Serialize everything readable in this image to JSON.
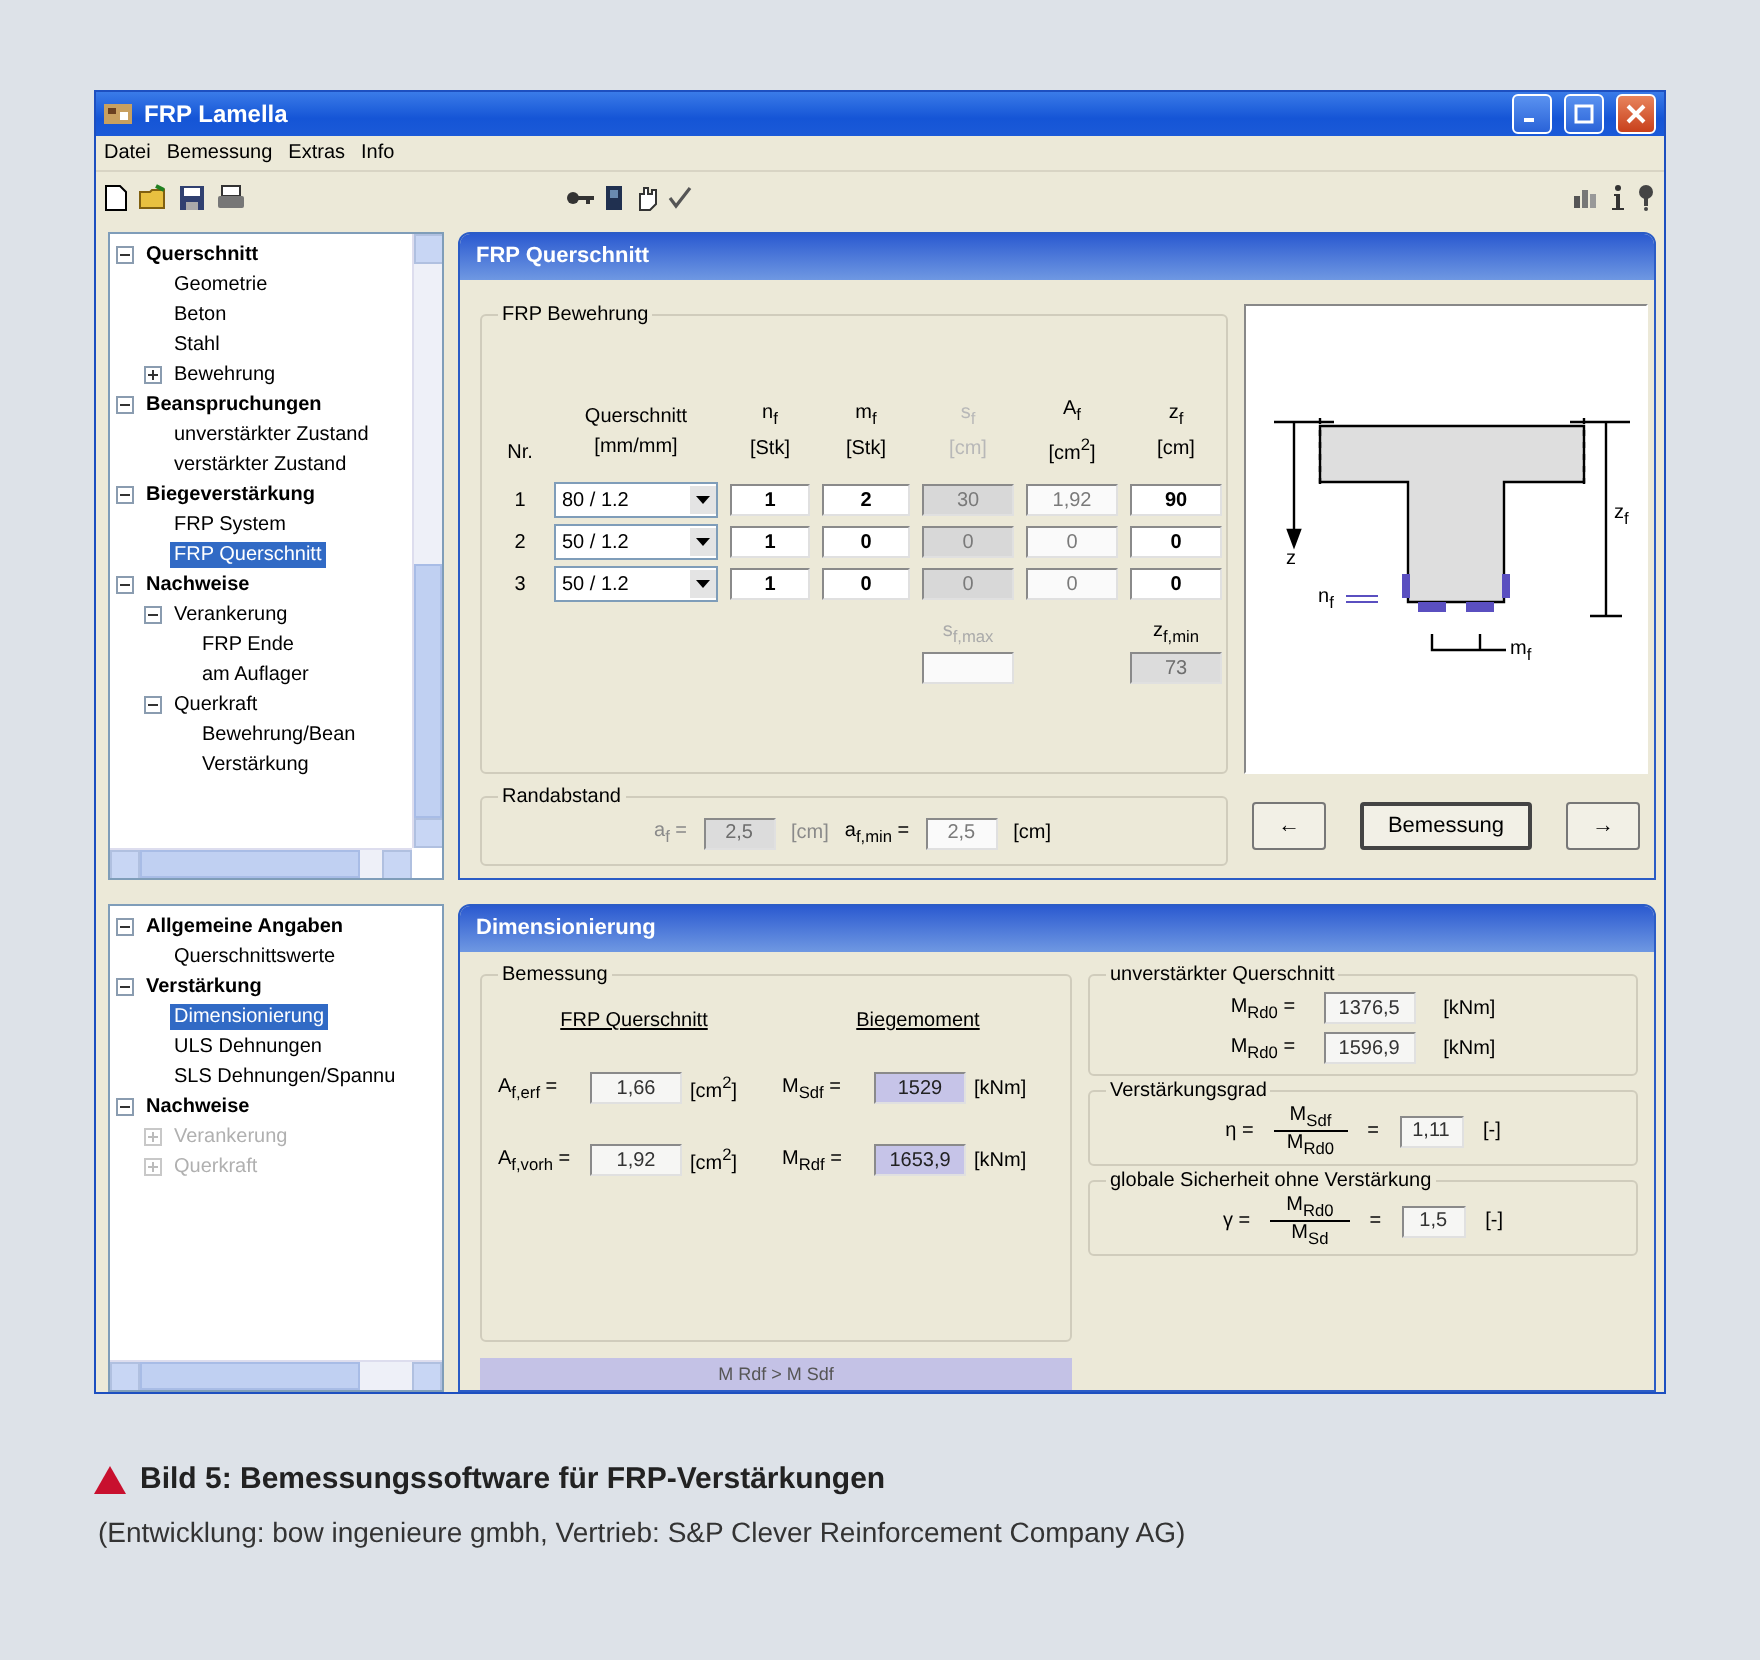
{
  "window": {
    "title": "FRP Lamella"
  },
  "menu": [
    "Datei",
    "Bemessung",
    "Extras",
    "Info"
  ],
  "tree_top": {
    "nodes": [
      {
        "label": "Querschnitt",
        "expanded": true,
        "selected": false,
        "children": [
          {
            "label": "Geometrie",
            "selected": false
          },
          {
            "label": "Beton",
            "selected": false
          },
          {
            "label": "Stahl",
            "selected": false
          },
          {
            "label": "Bewehrung",
            "expanded": false,
            "selected": false
          }
        ]
      },
      {
        "label": "Beanspruchungen",
        "expanded": true,
        "selected": false,
        "children": [
          {
            "label": "unverstärkter Zustand",
            "selected": false
          },
          {
            "label": "verstärkter Zustand",
            "selected": false
          }
        ]
      },
      {
        "label": "Biegeverstärkung",
        "expanded": true,
        "selected": false,
        "children": [
          {
            "label": "FRP System",
            "selected": false
          },
          {
            "label": "FRP Querschnitt",
            "selected": true
          }
        ]
      },
      {
        "label": "Nachweise",
        "expanded": true,
        "selected": false,
        "children": [
          {
            "label": "Verankerung",
            "expanded": true,
            "selected": false,
            "children": [
              {
                "label": "FRP Ende",
                "selected": false
              },
              {
                "label": "am Auflager",
                "selected": false
              }
            ]
          },
          {
            "label": "Querkraft",
            "expanded": true,
            "selected": false,
            "children": [
              {
                "label": "Bewehrung/Bean",
                "selected": false
              },
              {
                "label": "Verstärkung",
                "selected": false
              }
            ]
          }
        ]
      }
    ]
  },
  "panel_top": {
    "title": "FRP Querschnitt",
    "group": "FRP Bewehrung",
    "columns": [
      {
        "label": "Nr."
      },
      {
        "label": "Querschnitt",
        "unit": "[mm/mm]"
      },
      {
        "label": "n$_{f}$",
        "unit": "[Stk]"
      },
      {
        "label": "m$_{f}$",
        "unit": "[Stk]"
      },
      {
        "label": "s$_{f}$",
        "unit": "[cm]",
        "disabled": true
      },
      {
        "label": "A$_{f}$",
        "unit": "[cm$^{2}$]"
      },
      {
        "label": "z$_{f}$",
        "unit": "[cm]"
      }
    ],
    "rows": [
      {
        "cells": [
          {
            "kind": "label",
            "value": "1"
          },
          {
            "kind": "dropdown",
            "value": "80 / 1.2"
          },
          {
            "kind": "field",
            "value": "1",
            "disabled": false,
            "readonly": false
          },
          {
            "kind": "field",
            "value": "2",
            "disabled": false,
            "readonly": false
          },
          {
            "kind": "field",
            "value": "30",
            "disabled": true,
            "readonly": true
          },
          {
            "kind": "field",
            "value": "1,92",
            "disabled": false,
            "readonly": true
          },
          {
            "kind": "field",
            "value": "90",
            "disabled": false,
            "readonly": false
          }
        ]
      },
      {
        "cells": [
          {
            "kind": "label",
            "value": "2"
          },
          {
            "kind": "dropdown",
            "value": "50 / 1.2"
          },
          {
            "kind": "field",
            "value": "1",
            "disabled": false,
            "readonly": false
          },
          {
            "kind": "field",
            "value": "0",
            "disabled": false,
            "readonly": false
          },
          {
            "kind": "field",
            "value": "0",
            "disabled": true,
            "readonly": true
          },
          {
            "kind": "field",
            "value": "0",
            "disabled": false,
            "readonly": true
          },
          {
            "kind": "field",
            "value": "0",
            "disabled": false,
            "readonly": false
          }
        ]
      },
      {
        "cells": [
          {
            "kind": "label",
            "value": "3"
          },
          {
            "kind": "dropdown",
            "value": "50 / 1.2"
          },
          {
            "kind": "field",
            "value": "1",
            "disabled": false,
            "readonly": false
          },
          {
            "kind": "field",
            "value": "0",
            "disabled": false,
            "readonly": false
          },
          {
            "kind": "field",
            "value": "0",
            "disabled": true,
            "readonly": true
          },
          {
            "kind": "field",
            "value": "0",
            "disabled": false,
            "readonly": true
          },
          {
            "kind": "field",
            "value": "0",
            "disabled": false,
            "readonly": false
          }
        ]
      }
    ],
    "s_max": {
      "label": "s$_{f,max}$",
      "disabled": false
    },
    "z_min": {
      "label": "z$_{f,min}$",
      "value": "73",
      "disabled": true
    },
    "edge": {
      "legend": "Randabstand",
      "fields": [
        {
          "label": "a$_{f}$ =",
          "value": "2,5",
          "unit": "[cm]",
          "disabled": true
        },
        {
          "label": "a$_{f,min}$ =",
          "value": "2,5",
          "unit": "[cm]",
          "disabled": false
        }
      ]
    },
    "diagram_labels": [
      "z",
      "z$_{f}$",
      "n$_{f}$",
      "m$_{f}$"
    ],
    "buttons": [
      "←",
      "Bemessung",
      "→"
    ]
  },
  "tree_bottom": {
    "nodes": [
      {
        "label": "Allgemeine Angaben",
        "expanded": true,
        "selected": false,
        "disabled": false,
        "children": [
          {
            "label": "Querschnittswerte",
            "selected": false,
            "disabled": false
          }
        ]
      },
      {
        "label": "Verstärkung",
        "expanded": true,
        "selected": false,
        "disabled": false,
        "children": [
          {
            "label": "Dimensionierung",
            "selected": true,
            "disabled": false
          },
          {
            "label": "ULS Dehnungen",
            "selected": false,
            "disabled": false
          },
          {
            "label": "SLS Dehnungen/Spannu",
            "selected": false,
            "disabled": false
          }
        ]
      },
      {
        "label": "Nachweise",
        "expanded": true,
        "selected": false,
        "disabled": false,
        "children": [
          {
            "label": "Verankerung",
            "expanded": false,
            "selected": false,
            "disabled": true
          },
          {
            "label": "Querkraft",
            "expanded": false,
            "selected": false,
            "disabled": true
          }
        ]
      }
    ]
  },
  "panel_bottom": {
    "title": "Dimensionierung",
    "group": "Bemessung",
    "columns": [
      {
        "heading": "FRP Querschnitt",
        "rows": [
          {
            "label": "A$_{f,erf}$ =",
            "value": "1,66",
            "unit": "[cm$^{2}$]",
            "highlighted": false
          },
          {
            "label": "A$_{f,vorh}$ =",
            "value": "1,92",
            "unit": "[cm$^{2}$]",
            "highlighted": false
          }
        ]
      },
      {
        "heading": "Biegemoment",
        "rows": [
          {
            "label": "M$_{Sdf}$ =",
            "value": "1529",
            "unit": "[kNm]",
            "highlighted": true
          },
          {
            "label": "M$_{Rdf}$ =",
            "value": "1653,9",
            "unit": "[kNm]",
            "highlighted": true
          }
        ]
      }
    ],
    "status": "M Rdf > M Sdf",
    "groups": [
      {
        "kind": "values",
        "legend": "unverstärkter Querschnitt",
        "rows": [
          {
            "label": "M$_{Rd0}$ =",
            "value": "1376,5",
            "unit": "[kNm]"
          },
          {
            "label": "M$_{Rd0}$ =",
            "value": "1596,9",
            "unit": "[kNm]"
          }
        ]
      },
      {
        "kind": "ratio",
        "legend": "Verstärkungsgrad",
        "symbol": "η =",
        "numerator": "M$_{Sdf}$",
        "denominator": "M$_{Rd0}$",
        "equals": "=",
        "value": "1,11",
        "unit": "[-]"
      },
      {
        "kind": "ratio",
        "legend": "globale Sicherheit ohne Verstärkung",
        "symbol": "γ =",
        "numerator": "M$_{Rd0}$",
        "denominator": "M$_{Sd}$",
        "equals": "=",
        "value": "1,5",
        "unit": "[-]"
      }
    ]
  },
  "caption": {
    "title": "Bild 5: Bemessungssoftware für FRP-Verstärkungen",
    "credit": "(Entwicklung: bow ingenieure gmbh, Vertrieb: S&P Clever Reinforcement Company AG)"
  }
}
